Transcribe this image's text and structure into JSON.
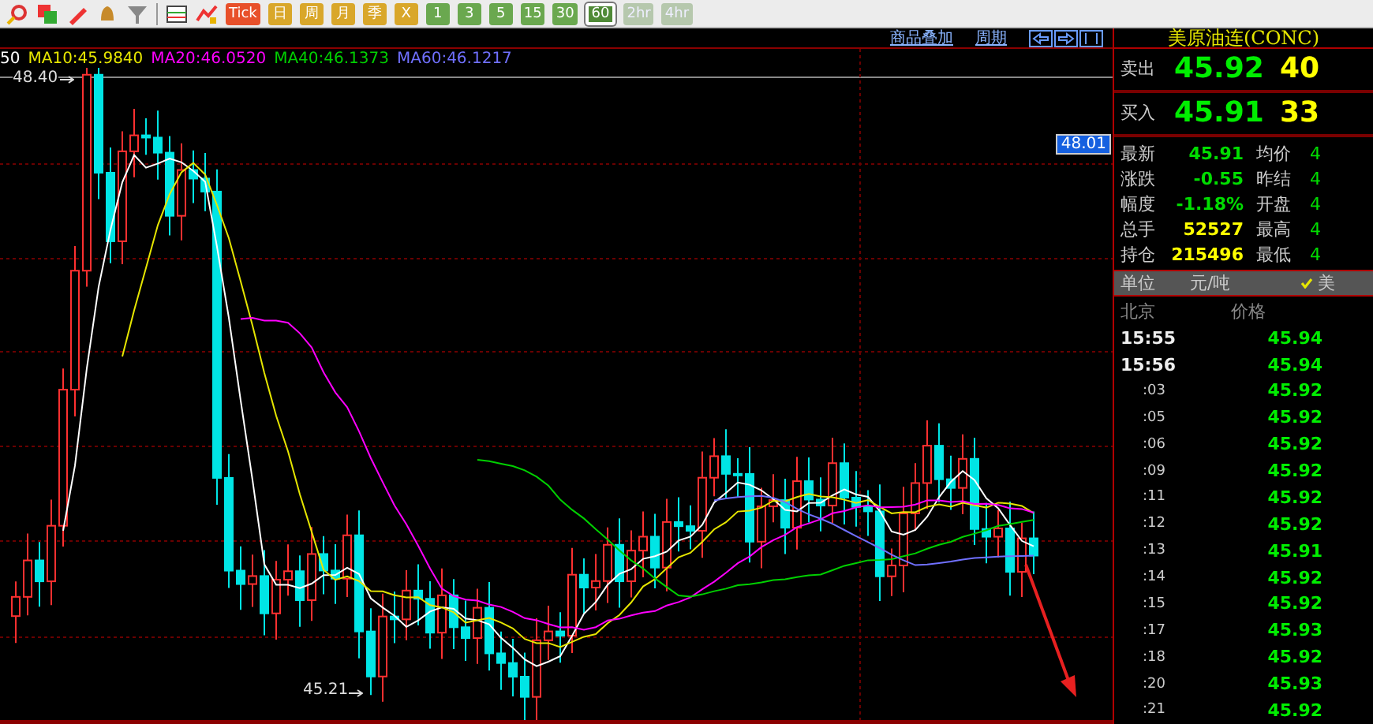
{
  "toolbar": {
    "periods": [
      {
        "label": "Tick",
        "kind": "red",
        "selected": false
      },
      {
        "label": "日",
        "kind": "gold",
        "selected": false
      },
      {
        "label": "周",
        "kind": "gold",
        "selected": false
      },
      {
        "label": "月",
        "kind": "gold",
        "selected": false
      },
      {
        "label": "季",
        "kind": "gold",
        "selected": false
      },
      {
        "label": "X",
        "kind": "gold",
        "selected": false
      },
      {
        "label": "1",
        "kind": "green",
        "selected": false
      },
      {
        "label": "3",
        "kind": "green",
        "selected": false
      },
      {
        "label": "5",
        "kind": "green",
        "selected": false
      },
      {
        "label": "15",
        "kind": "green",
        "selected": false
      },
      {
        "label": "30",
        "kind": "green",
        "selected": false
      },
      {
        "label": "60",
        "kind": "green",
        "selected": true
      },
      {
        "label": "2hr",
        "kind": "faded",
        "selected": false
      },
      {
        "label": "4hr",
        "kind": "faded",
        "selected": false
      }
    ]
  },
  "chart": {
    "links": [
      "商品叠加",
      "周期"
    ],
    "legend": [
      {
        "label": "50",
        "color": "#ffffff"
      },
      {
        "label": "MA10:45.9840",
        "color": "#e6e600"
      },
      {
        "label": "MA20:46.0520",
        "color": "#ff00ff"
      },
      {
        "label": "MA40:46.1373",
        "color": "#00d000"
      },
      {
        "label": "MA60:46.1217",
        "color": "#7070ff"
      }
    ],
    "high_label": "48.40",
    "low_label": "45.21",
    "cursor_price": "48.01"
  },
  "quote": {
    "title": "美原油连(CONC)",
    "book": [
      {
        "label": "卖出",
        "price": "45.92",
        "volume": "40"
      },
      {
        "label": "买入",
        "price": "45.91",
        "volume": "33"
      }
    ],
    "stats": [
      {
        "label": "最新",
        "value": "45.91",
        "kind": "price",
        "label_2": "均价",
        "value_2": "4"
      },
      {
        "label": "涨跌",
        "value": "-0.55",
        "kind": "price",
        "label_2": "昨结",
        "value_2": "4"
      },
      {
        "label": "幅度",
        "value": "-1.18%",
        "kind": "price",
        "label_2": "开盘",
        "value_2": "4"
      },
      {
        "label": "总手",
        "value": "52527",
        "kind": "volume",
        "label_2": "最高",
        "value_2": "4"
      },
      {
        "label": "持仓",
        "value": "215496",
        "kind": "volume",
        "label_2": "最低",
        "value_2": "4"
      }
    ],
    "unit": {
      "label": "单位",
      "value": "元/吨",
      "option": "美",
      "checked": true
    },
    "ticks_header": [
      "北京",
      "价格"
    ],
    "ticks": [
      {
        "time": "15:55",
        "price": "45.94",
        "kind": "full"
      },
      {
        "time": "15:56",
        "price": "45.94",
        "kind": "full"
      },
      {
        "time": ":03",
        "price": "45.92",
        "kind": "minute"
      },
      {
        "time": ":05",
        "price": "45.92",
        "kind": "minute"
      },
      {
        "time": ":06",
        "price": "45.92",
        "kind": "minute"
      },
      {
        "time": ":09",
        "price": "45.92",
        "kind": "minute"
      },
      {
        "time": ":11",
        "price": "45.92",
        "kind": "minute"
      },
      {
        "time": ":12",
        "price": "45.92",
        "kind": "minute"
      },
      {
        "time": ":13",
        "price": "45.91",
        "kind": "minute"
      },
      {
        "time": ":14",
        "price": "45.92",
        "kind": "minute"
      },
      {
        "time": ":15",
        "price": "45.92",
        "kind": "minute"
      },
      {
        "time": ":17",
        "price": "45.93",
        "kind": "minute"
      },
      {
        "time": ":18",
        "price": "45.92",
        "kind": "minute"
      },
      {
        "time": ":20",
        "price": "45.93",
        "kind": "minute"
      },
      {
        "time": ":21",
        "price": "45.92",
        "kind": "minute"
      }
    ]
  }
}
